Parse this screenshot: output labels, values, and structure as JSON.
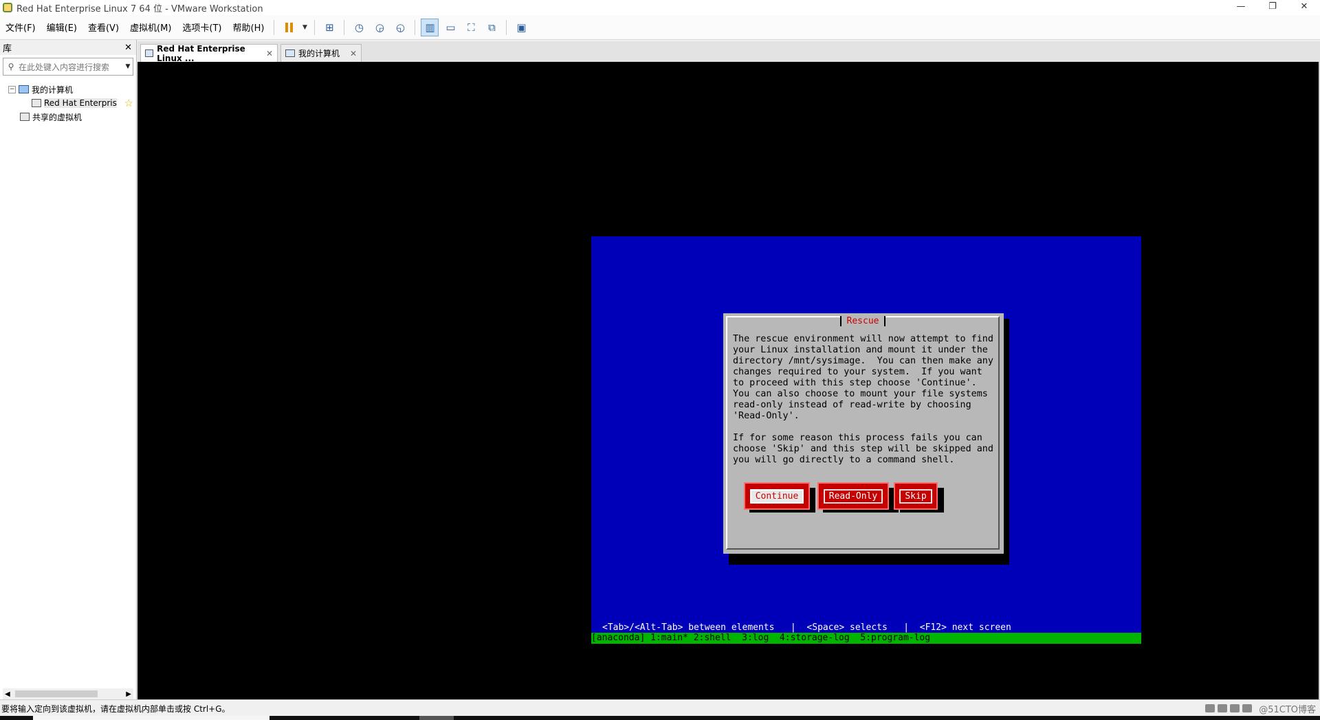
{
  "window": {
    "title": "Red Hat Enterprise Linux 7 64 位 - VMware Workstation",
    "controls": [
      "—",
      "❐",
      "✕"
    ]
  },
  "menu": {
    "items": [
      "文件(F)",
      "编辑(E)",
      "查看(V)",
      "虚拟机(M)",
      "选项卡(T)",
      "帮助(H)"
    ]
  },
  "library": {
    "title": "库",
    "close": "✕",
    "search_placeholder": "在此处键入内容进行搜索",
    "tree": {
      "my_computer": "我的计算机",
      "vm": "Red Hat Enterpris",
      "shared": "共享的虚拟机"
    }
  },
  "tabs": [
    {
      "label": "Red Hat Enterprise Linux ...",
      "close": "✕"
    },
    {
      "label": "我的计算机",
      "close": "✕"
    }
  ],
  "dialog": {
    "title": "Rescue",
    "body": "The rescue environment will now attempt to find\nyour Linux installation and mount it under the\ndirectory /mnt/sysimage.  You can then make any\nchanges required to your system.  If you want\nto proceed with this step choose 'Continue'.\nYou can also choose to mount your file systems\nread-only instead of read-write by choosing\n'Read-Only'.\n\nIf for some reason this process fails you can\nchoose 'Skip' and this step will be skipped and\nyou will go directly to a command shell.",
    "buttons": {
      "continue": "Continue",
      "readonly": "Read-Only",
      "skip": "Skip"
    }
  },
  "terminal": {
    "hint": "<Tab>/<Alt-Tab> between elements   |  <Space> selects   |  <F12> next screen",
    "statusline": "[anaconda] 1:main* 2:shell  3:log  4:storage-log  5:program-log"
  },
  "statusbar": {
    "message": "要将输入定向到该虚拟机，请在虚拟机内部单击或按 Ctrl+G。",
    "watermark": "@51CTO博客"
  },
  "colors": {
    "terminal_bg": "#0000b8",
    "dialog_bg": "#b8b8b8",
    "button_bg": "#c40000",
    "statusline_bg": "#00b400"
  }
}
